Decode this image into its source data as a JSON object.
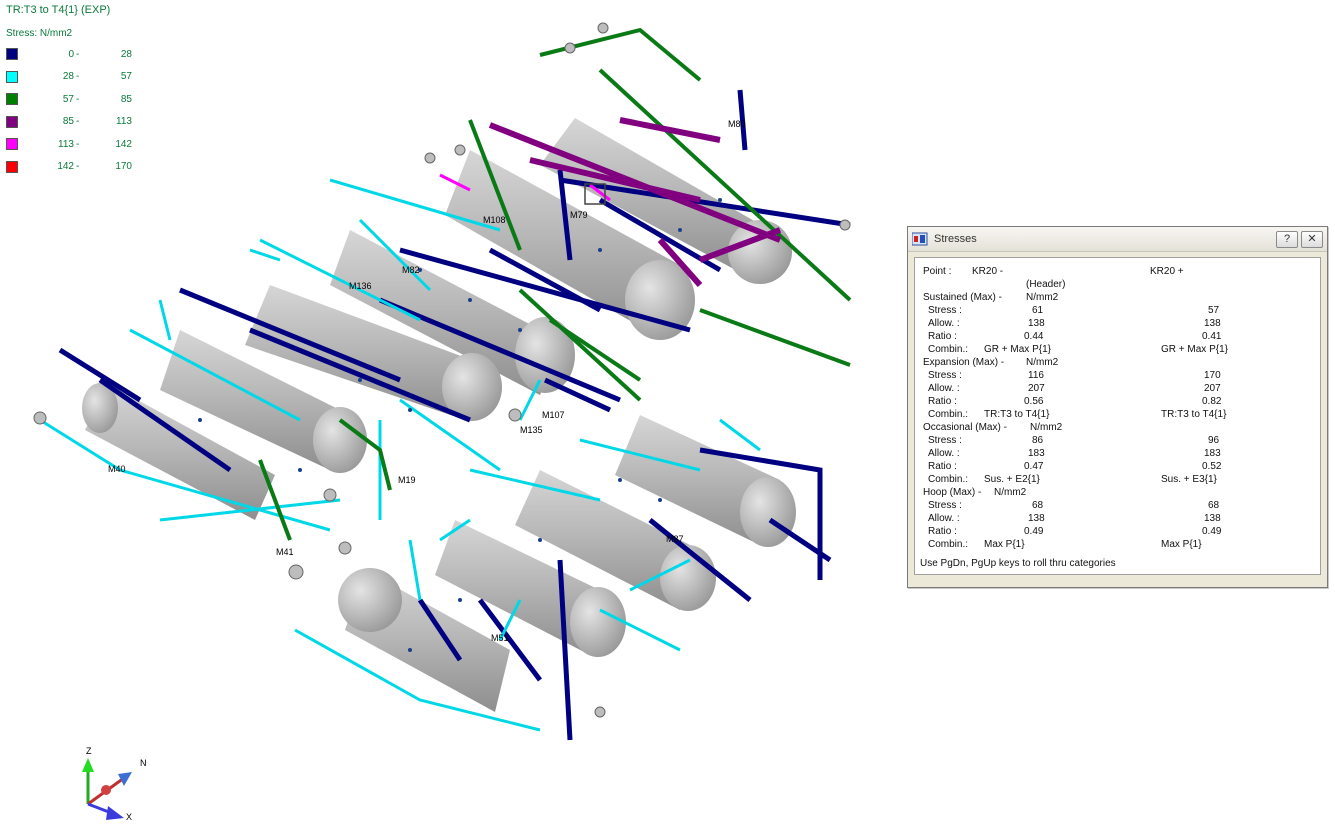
{
  "legend": {
    "title": "TR:T3 to T4{1}  (EXP)",
    "header": "Stress:  N/mm2",
    "rows": [
      {
        "color": "#000080",
        "from": "0",
        "to": "28"
      },
      {
        "color": "#00ffff",
        "from": "28",
        "to": "57"
      },
      {
        "color": "#008000",
        "from": "57",
        "to": "85"
      },
      {
        "color": "#800080",
        "from": "85",
        "to": "113"
      },
      {
        "color": "#ff00ff",
        "from": "113",
        "to": "142"
      },
      {
        "color": "#ff0000",
        "from": "142",
        "to": "170"
      }
    ],
    "sep": "-"
  },
  "model_labels": {
    "m40": "M40",
    "m41": "M41",
    "m19": "M19",
    "m135": "M135",
    "m136": "M136",
    "m107": "M107",
    "m108": "M108",
    "m79": "M79",
    "m51": "M51",
    "m87": "M87",
    "m80": "M80",
    "m82": "M82"
  },
  "axes": {
    "z": "Z",
    "n": "N",
    "x": "X"
  },
  "stresses_window": {
    "title": "Stresses",
    "help_button": "?",
    "close_button": "✕",
    "point_label": "Point :",
    "point_a": "KR20  -",
    "point_b": "KR20  +",
    "point_note": "(Header)",
    "categories": [
      {
        "name": "Sustained (Max) -",
        "unit": "N/mm2",
        "stress": [
          "61",
          "57"
        ],
        "allow": [
          "138",
          "138"
        ],
        "ratio": [
          "0.44",
          "0.41"
        ],
        "combin": [
          "GR + Max P{1}",
          "GR + Max P{1}"
        ]
      },
      {
        "name": "Expansion (Max) -",
        "unit": "N/mm2",
        "stress": [
          "116",
          "170"
        ],
        "allow": [
          "207",
          "207"
        ],
        "ratio": [
          "0.56",
          "0.82"
        ],
        "combin": [
          "TR:T3 to T4{1}",
          "TR:T3 to T4{1}"
        ]
      },
      {
        "name": "Occasional (Max) -",
        "unit": "N/mm2",
        "stress": [
          "86",
          "96"
        ],
        "allow": [
          "183",
          "183"
        ],
        "ratio": [
          "0.47",
          "0.52"
        ],
        "combin": [
          "Sus. + E2{1}",
          "Sus. + E3{1}"
        ]
      },
      {
        "name": "Hoop (Max) -",
        "unit": "N/mm2",
        "stress": [
          "68",
          "68"
        ],
        "allow": [
          "138",
          "138"
        ],
        "ratio": [
          "0.49",
          "0.49"
        ],
        "combin": [
          "Max P{1}",
          "Max P{1}"
        ]
      }
    ],
    "row_labels": {
      "stress": "Stress :",
      "allow": "Allow. :",
      "ratio": "Ratio  :",
      "combin": "Combin.:"
    },
    "footer": "Use PgDn, PgUp keys to roll thru categories"
  }
}
